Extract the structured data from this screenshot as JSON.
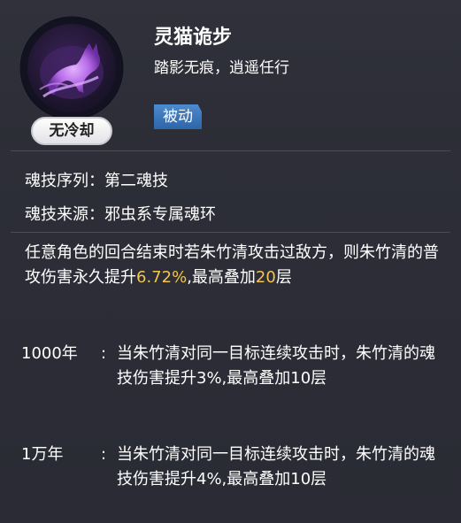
{
  "skill": {
    "name": "灵猫诡步",
    "subtitle": "踏影无痕，逍遥任行",
    "type_tag": "被动",
    "cooldown": "无冷却",
    "icon": "spirit-cat-icon"
  },
  "meta": {
    "sequence_label": "魂技序列：",
    "sequence_value": "第二魂技",
    "source_label": "魂技来源：",
    "source_value": "邪虫系专属魂环"
  },
  "description": {
    "part1": "任意角色的回合结束时若朱竹清攻击过敌方，则朱竹清的普攻伤害永久提升",
    "value1": "6.72%",
    "part2": ",最高叠加",
    "value2": "20",
    "part3": "层"
  },
  "tiers": [
    {
      "label": "1000年",
      "colon": ":",
      "text": "当朱竹清对同一目标连续攻击时，朱竹清的魂技伤害提升3%,最高叠加10层"
    },
    {
      "label": "1万年",
      "colon": ":",
      "text": "当朱竹清对同一目标连续攻击时，朱竹清的魂技伤害提升4%,最高叠加10层"
    }
  ],
  "colors": {
    "background": "#2b2c35",
    "highlight": "#f3c64d",
    "tag": "#3b74bb"
  }
}
